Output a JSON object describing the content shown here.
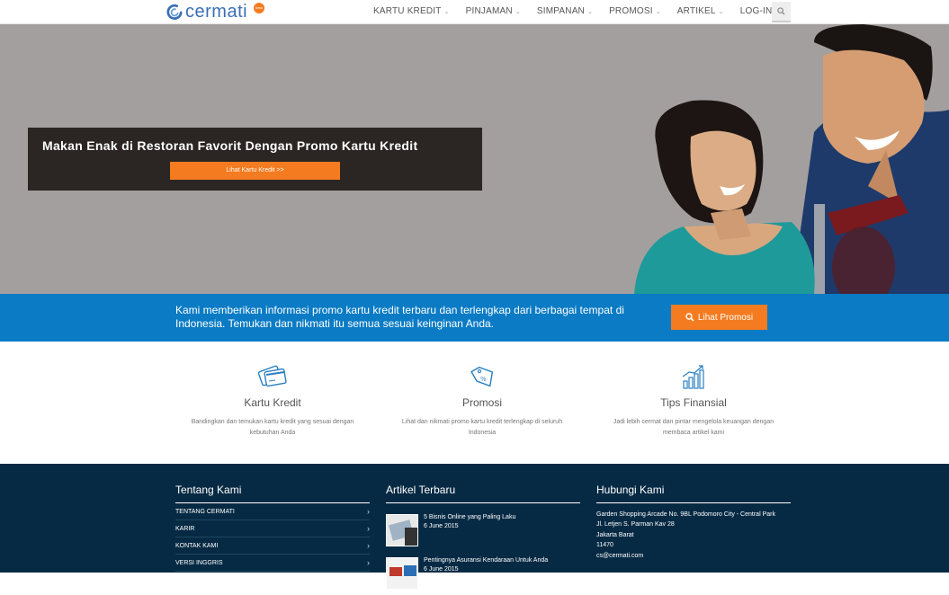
{
  "navbar": {
    "logo_text": "cermati",
    "logo_badge": "beta",
    "menu": [
      {
        "label": "KARTU KREDIT",
        "caret": "⌄"
      },
      {
        "label": "PINJAMAN",
        "caret": "⌄"
      },
      {
        "label": "SIMPANAN",
        "caret": "⌄"
      },
      {
        "label": "PROMOSI",
        "caret": "⌄"
      },
      {
        "label": "ARTIKEL",
        "caret": "⌄"
      },
      {
        "label": "LOG-IN",
        "caret": ""
      }
    ],
    "search_icon": "search-icon"
  },
  "hero": {
    "title": "Makan Enak di Restoran Favorit Dengan Promo Kartu Kredit",
    "button_label": "Lihat Kartu Kredit >>",
    "image": "couple-dining-photo"
  },
  "strip": {
    "text": "Kami memberikan informasi promo kartu kredit terbaru dan terlengkap dari berbagai tempat di Indonesia. Temukan dan nikmati itu semua sesuai keinginan Anda.",
    "button_label": "Lihat Promosi",
    "button_icon": "search-icon"
  },
  "features": [
    {
      "icon": "credit-card-icon",
      "title": "Kartu Kredit",
      "desc": "Bandingkan dan temukan kartu kredit yang sesuai dengan kebutuhan Anda"
    },
    {
      "icon": "price-tag-icon",
      "title": "Promosi",
      "desc": "Lihat dan nikmati promo kartu kredit terlengkap di seluruh Indonesia"
    },
    {
      "icon": "growth-chart-icon",
      "title": "Tips Finansial",
      "desc": "Jadi lebih cermat dan pintar mengelola keuangan dengan membaca artikel kami"
    }
  ],
  "footer": {
    "about": {
      "title": "Tentang Kami",
      "links": [
        "TENTANG CERMATI",
        "KARIR",
        "KONTAK KAMI",
        "VERSI INGGRIS"
      ],
      "chevron": "›"
    },
    "articles": {
      "title": "Artikel Terbaru",
      "items": [
        {
          "title": "5 Bisnis Online yang Paling Laku",
          "date": "6 June 2015"
        },
        {
          "title": "Pentingnya Asuransi Kendaraan Untuk Anda",
          "date": "6 June 2015"
        }
      ]
    },
    "contact": {
      "title": "Hubungi Kami",
      "lines": [
        "Garden Shopping Arcade No. 9BL Podomoro City - Central Park",
        "Jl. Letjen S. Parman Kav 28",
        "Jakarta Barat",
        "11470",
        "cs@cermati.com"
      ]
    }
  }
}
